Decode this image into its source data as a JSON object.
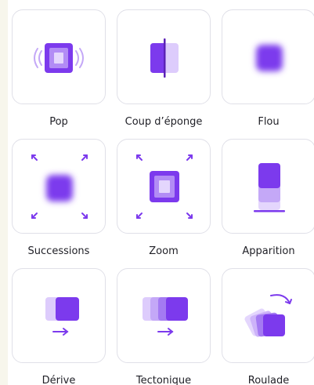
{
  "colors": {
    "primary": "#7c3aed",
    "light": "#c4a8f7",
    "pale": "#e4d6fd",
    "border": "#e0e0e8",
    "text": "#1f1f26"
  },
  "animations": [
    {
      "label": "Pop",
      "icon": "pop-icon"
    },
    {
      "label": "Coup d’éponge",
      "icon": "wipe-icon"
    },
    {
      "label": "Flou",
      "icon": "blur-icon"
    },
    {
      "label": "Successions",
      "icon": "succession-icon"
    },
    {
      "label": "Zoom",
      "icon": "zoom-icon"
    },
    {
      "label": "Apparition",
      "icon": "rise-icon"
    },
    {
      "label": "Dérive",
      "icon": "drift-icon"
    },
    {
      "label": "Tectonique",
      "icon": "tectonic-icon"
    },
    {
      "label": "Roulade",
      "icon": "tumble-icon"
    }
  ]
}
